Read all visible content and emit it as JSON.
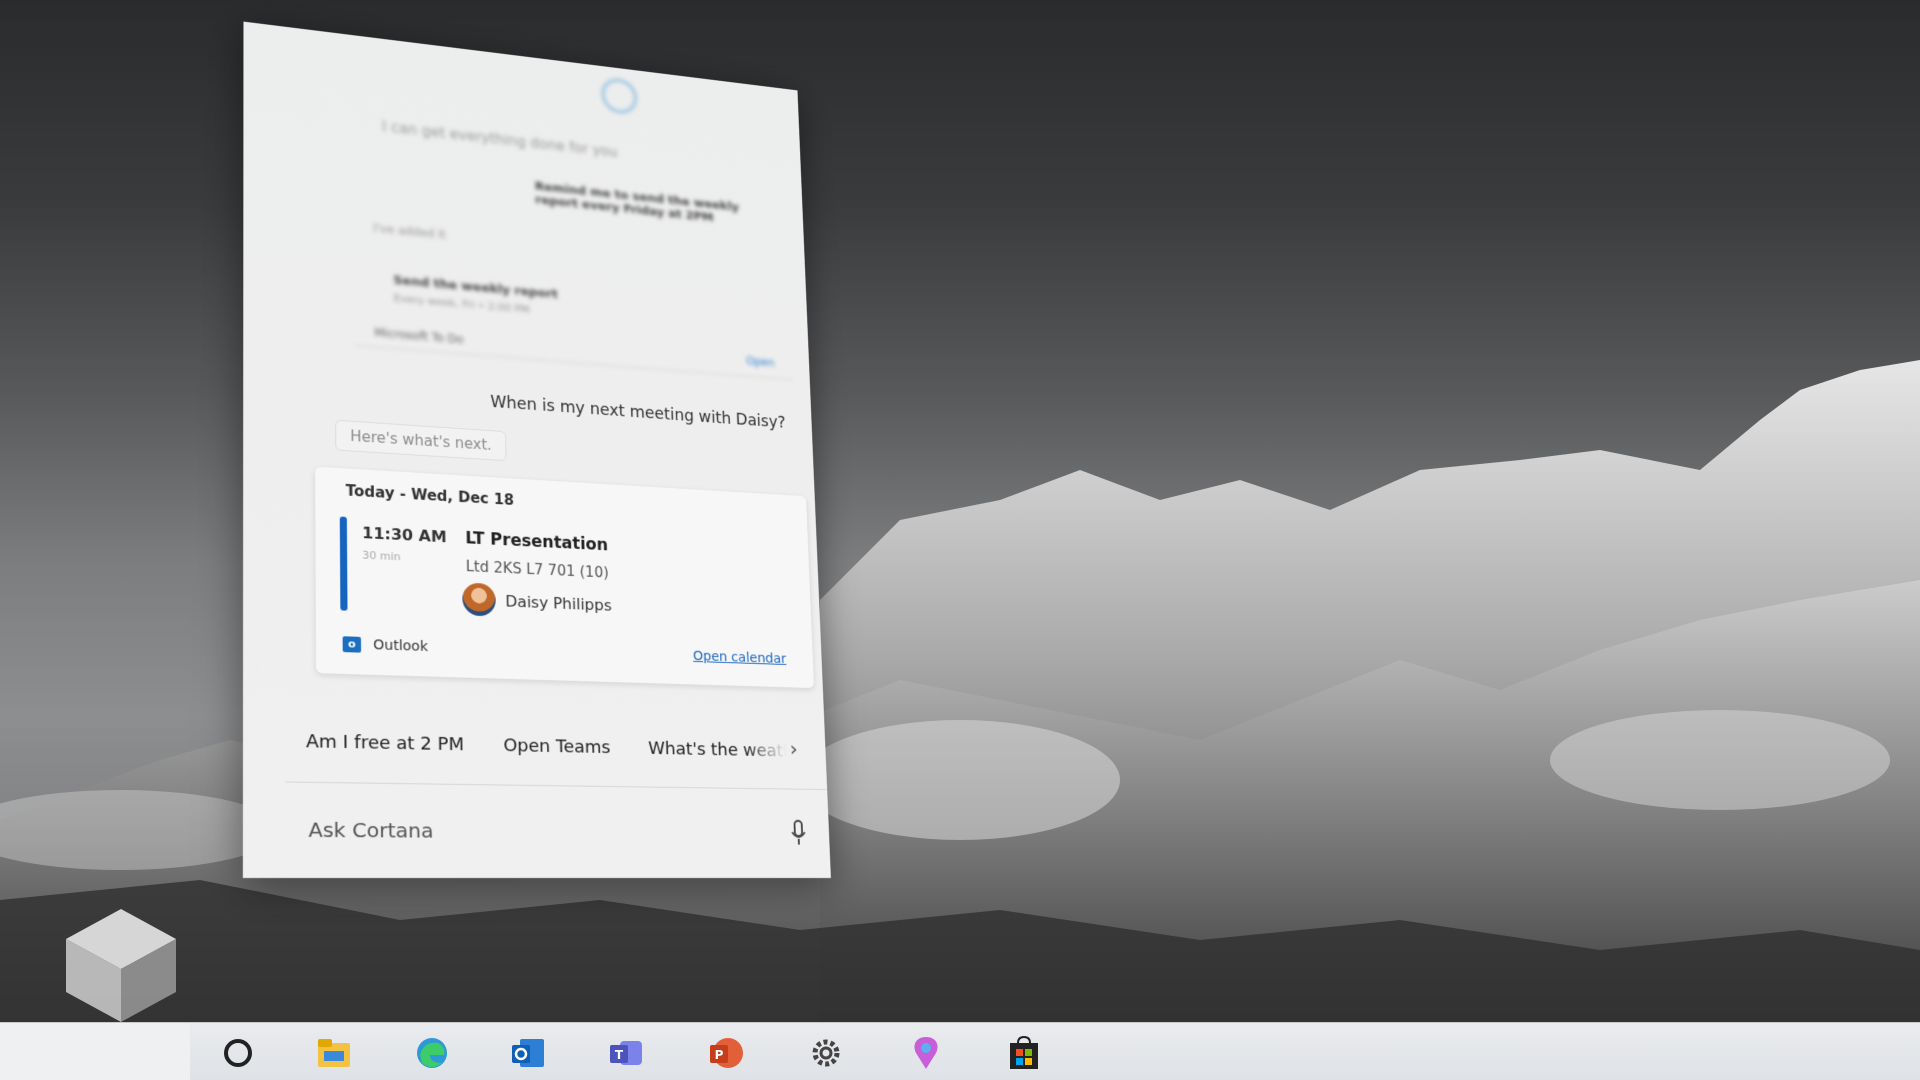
{
  "cortana": {
    "previous_prompt": "I can get everything done for you",
    "previous_response": "Remind me to send the weekly report every Friday at 2PM",
    "previous_label": "I've added it",
    "previous_task_title": "Send the weekly report",
    "previous_task_sub": "Every week, Fri • 2:00 PM",
    "previous_source": "Microsoft To Do",
    "previous_open": "Open",
    "user_query": "When is my next meeting with Daisy?",
    "reply": "Here's what's next.",
    "card": {
      "date": "Today - Wed, Dec 18",
      "time": "11:30 AM",
      "duration": "30 min",
      "title": "LT Presentation",
      "room": "Ltd 2KS L7 701 (10)",
      "attendee": "Daisy Philipps",
      "source": "Outlook",
      "open_calendar": "Open calendar"
    },
    "suggestions": [
      "Am I free at 2 PM",
      "Open Teams",
      "What's the weather"
    ],
    "input_placeholder": "Ask Cortana"
  },
  "taskbar": {
    "icons": [
      "cortana-icon",
      "file-explorer-icon",
      "edge-icon",
      "outlook-icon",
      "teams-icon",
      "powerpoint-icon",
      "settings-icon",
      "maps-icon",
      "store-icon"
    ]
  },
  "colors": {
    "accent": "#1565c0",
    "link": "#1a66c2"
  }
}
